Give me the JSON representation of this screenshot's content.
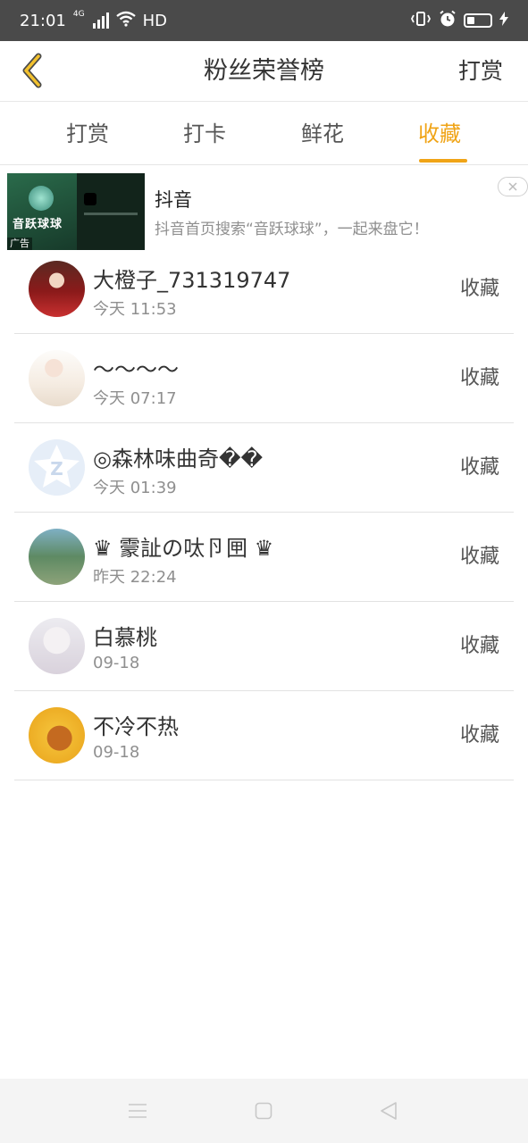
{
  "status_bar": {
    "time": "21:01",
    "network": "4G",
    "hd": "HD"
  },
  "header": {
    "title": "粉丝荣誉榜",
    "action_label": "打赏"
  },
  "tabs": [
    {
      "label": "打赏",
      "active": false
    },
    {
      "label": "打卡",
      "active": false
    },
    {
      "label": "鲜花",
      "active": false
    },
    {
      "label": "收藏",
      "active": true
    }
  ],
  "ad": {
    "title": "抖音",
    "description": "抖音首页搜索“音跃球球”，一起来盘它！",
    "image_text": "音跃球球",
    "badge": "广告"
  },
  "fans": [
    {
      "name": "大橙子_731319747",
      "time": "今天 11:53",
      "action": "收藏"
    },
    {
      "name": "～～～～",
      "time": "今天 07:17",
      "action": "收藏"
    },
    {
      "name": "◎森林味曲奇��",
      "time": "今天 01:39",
      "action": "收藏"
    },
    {
      "name": "♛ 霥訨の呔卪㘡 ♛",
      "time": "昨天 22:24",
      "action": "收藏"
    },
    {
      "name": "白慕桃",
      "time": "09-18",
      "action": "收藏"
    },
    {
      "name": "不冷不热",
      "time": "09-18",
      "action": "收藏"
    }
  ],
  "colors": {
    "accent": "#f0a417",
    "status_bar": "#4a4a4a"
  }
}
